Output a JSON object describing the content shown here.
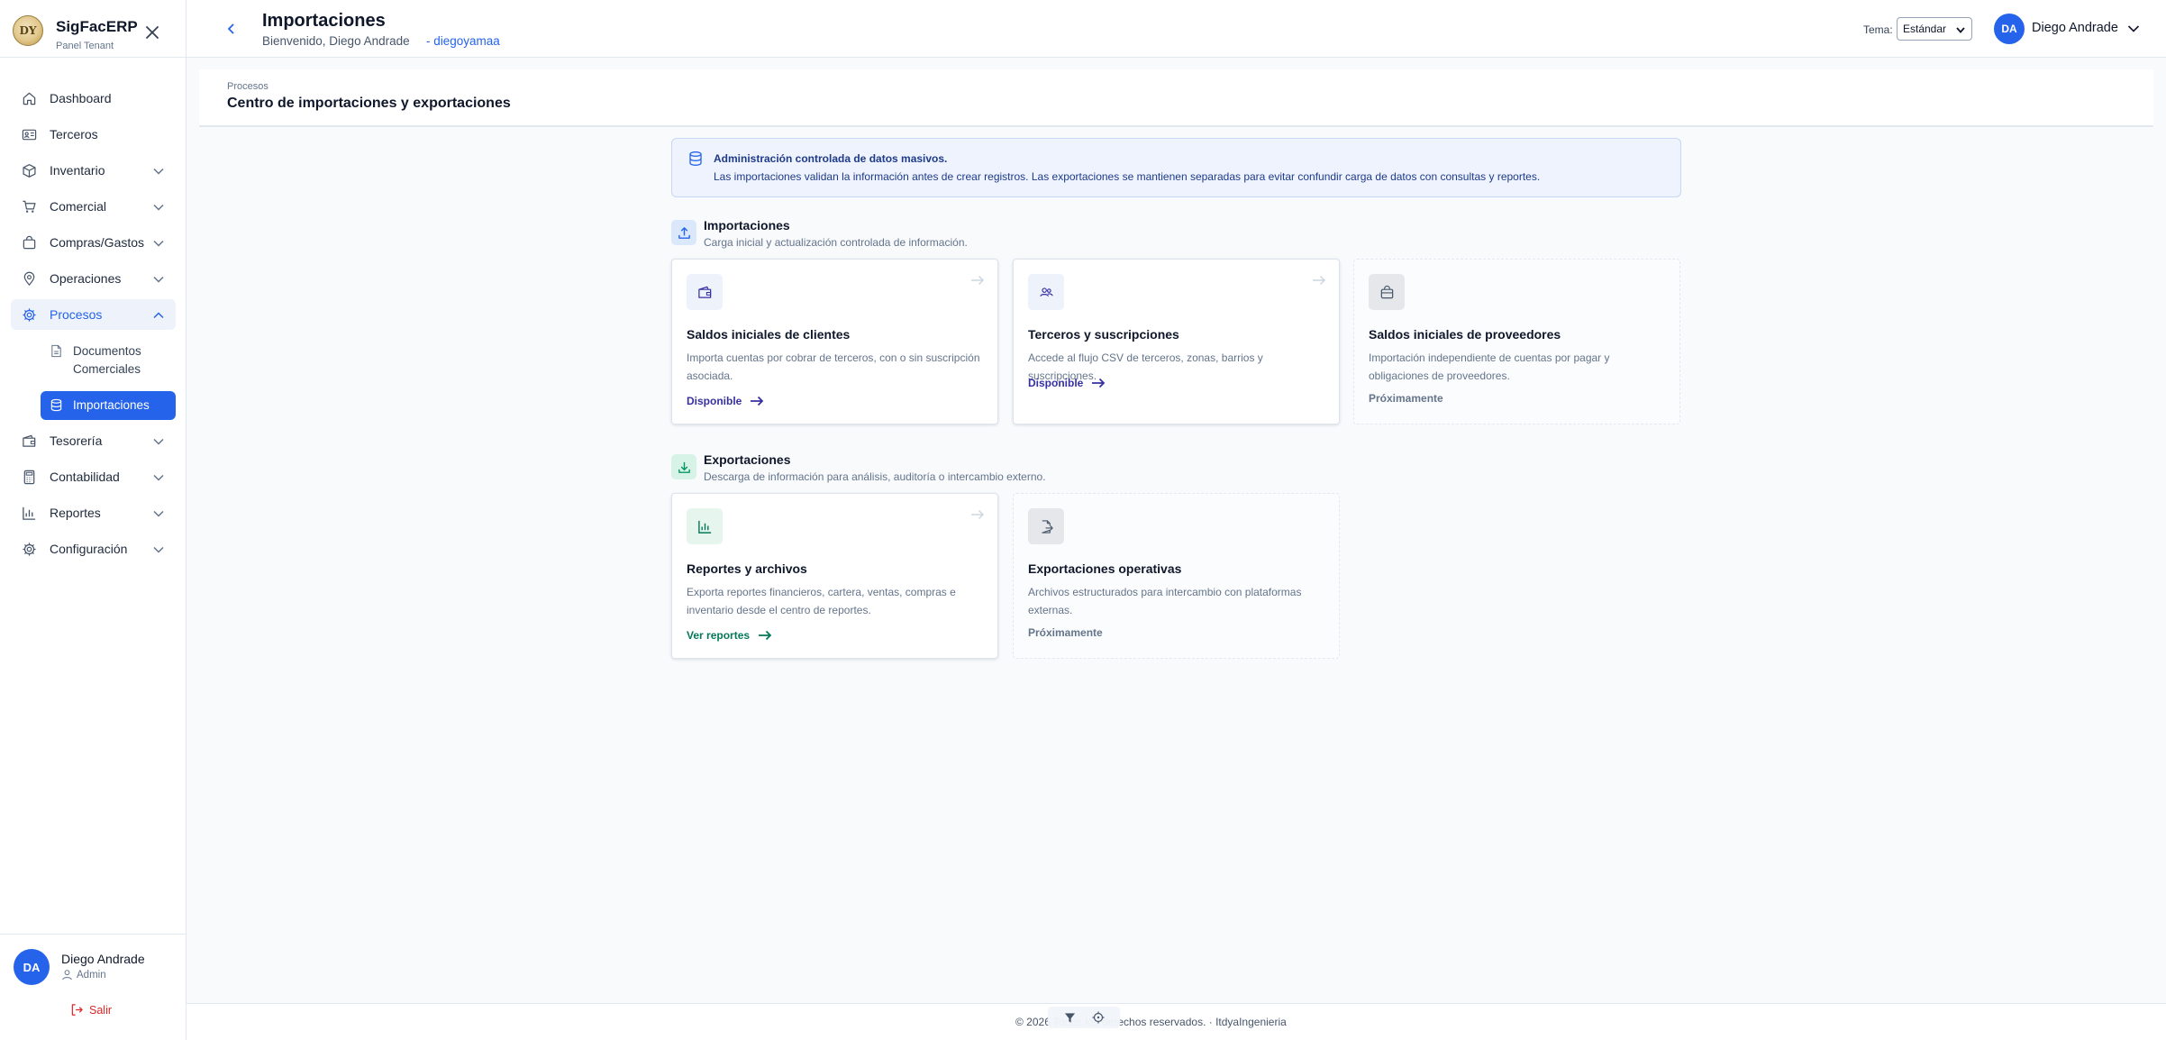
{
  "sidebar": {
    "brand_name": "SigFacERP",
    "brand_sub": "Panel Tenant",
    "logo_text": "DY",
    "items": [
      {
        "label": "Dashboard",
        "icon": "home-icon"
      },
      {
        "label": "Terceros",
        "icon": "id-card-icon"
      },
      {
        "label": "Inventario",
        "icon": "box-icon"
      },
      {
        "label": "Comercial",
        "icon": "cart-icon"
      },
      {
        "label": "Compras/Gastos",
        "icon": "shopping-bag-icon"
      },
      {
        "label": "Operaciones",
        "icon": "map-pin-icon"
      },
      {
        "label": "Procesos",
        "icon": "gear-icon"
      },
      {
        "label": "Tesorería",
        "icon": "wallet-icon"
      },
      {
        "label": "Contabilidad",
        "icon": "calculator-icon"
      },
      {
        "label": "Reportes",
        "icon": "bar-chart-icon"
      },
      {
        "label": "Configuración",
        "icon": "gear-icon"
      }
    ],
    "sub_items": [
      {
        "label": "Documentos Comerciales",
        "icon": "document-icon"
      },
      {
        "label": "Importaciones",
        "icon": "database-icon"
      }
    ],
    "user": {
      "initials": "DA",
      "name": "Diego Andrade",
      "role": "Admin",
      "logout": "Salir"
    }
  },
  "header": {
    "title": "Importaciones",
    "welcome": "Bienvenido, Diego Andrade",
    "tenant": "- diegoyamaa",
    "tema_label": "Tema:",
    "tema_value": "Estándar",
    "user_initials": "DA",
    "user_name": "Diego Andrade"
  },
  "page": {
    "breadcrumb": "Procesos",
    "title": "Centro de importaciones y exportaciones"
  },
  "banner": {
    "title": "Administración controlada de datos masivos.",
    "text": "Las importaciones validan la información antes de crear registros. Las exportaciones se mantienen separadas para evitar confundir carga de datos con consultas y reportes."
  },
  "imports": {
    "title": "Importaciones",
    "subtitle": "Carga inicial y actualización controlada de información.",
    "cards": [
      {
        "title": "Saldos iniciales de clientes",
        "desc": "Importa cuentas por cobrar de terceros, con o sin suscripción asociada.",
        "status": "Disponible",
        "icon": "wallet-icon"
      },
      {
        "title": "Terceros y suscripciones",
        "desc": "Accede al flujo CSV de terceros, zonas, barrios y suscripciones.",
        "status": "Disponible",
        "icon": "users-icon"
      },
      {
        "title": "Saldos iniciales de proveedores",
        "desc": "Importación independiente de cuentas por pagar y obligaciones de proveedores.",
        "status": "Próximamente",
        "icon": "briefcase-icon"
      }
    ]
  },
  "exports": {
    "title": "Exportaciones",
    "subtitle": "Descarga de información para análisis, auditoría o intercambio externo.",
    "cards": [
      {
        "title": "Reportes y archivos",
        "desc": "Exporta reportes financieros, cartera, ventas, compras e inventario desde el centro de reportes.",
        "status": "Ver reportes",
        "icon": "bar-chart-icon"
      },
      {
        "title": "Exportaciones operativas",
        "desc": "Archivos estructurados para intercambio con plataformas externas.",
        "status": "Próximamente",
        "icon": "file-export-icon"
      }
    ]
  },
  "footer": {
    "text": "© 2026 Todos los derechos reservados. · ItdyaIngenieria"
  },
  "colors": {
    "primary": "#2563eb",
    "indigo_link": "#3730a3",
    "green_link": "#047857",
    "banner_bg": "#eef3fd",
    "danger": "#dc2626"
  }
}
